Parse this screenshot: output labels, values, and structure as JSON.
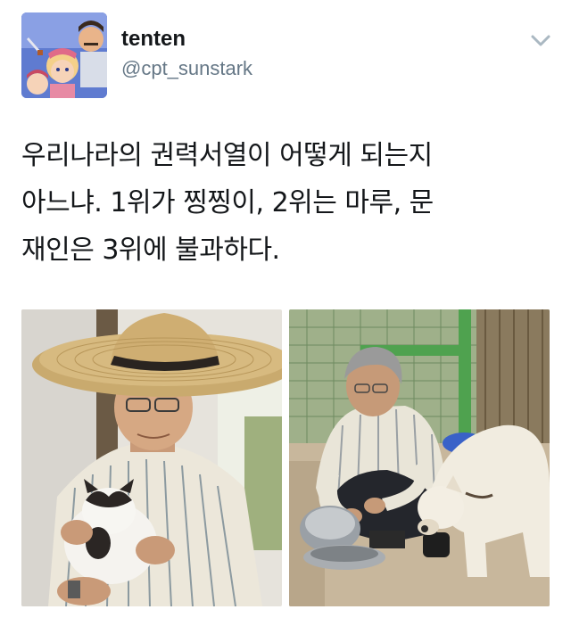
{
  "tweet": {
    "display_name": "tenten",
    "handle": "@cpt_sunstark",
    "text_lines": [
      "우리나라의 권력서열이 어떻게 되는지",
      "아느냐. 1위가 찡찡이, 2위는 마루, 문",
      "재인은 3위에 불과하다."
    ]
  },
  "icons": {
    "avatar": "cartoon-avatar",
    "menu": "chevron-down-icon"
  },
  "colors": {
    "name": "#14171a",
    "handle": "#657786",
    "text": "#14171a",
    "chevron": "#aab8c2"
  }
}
